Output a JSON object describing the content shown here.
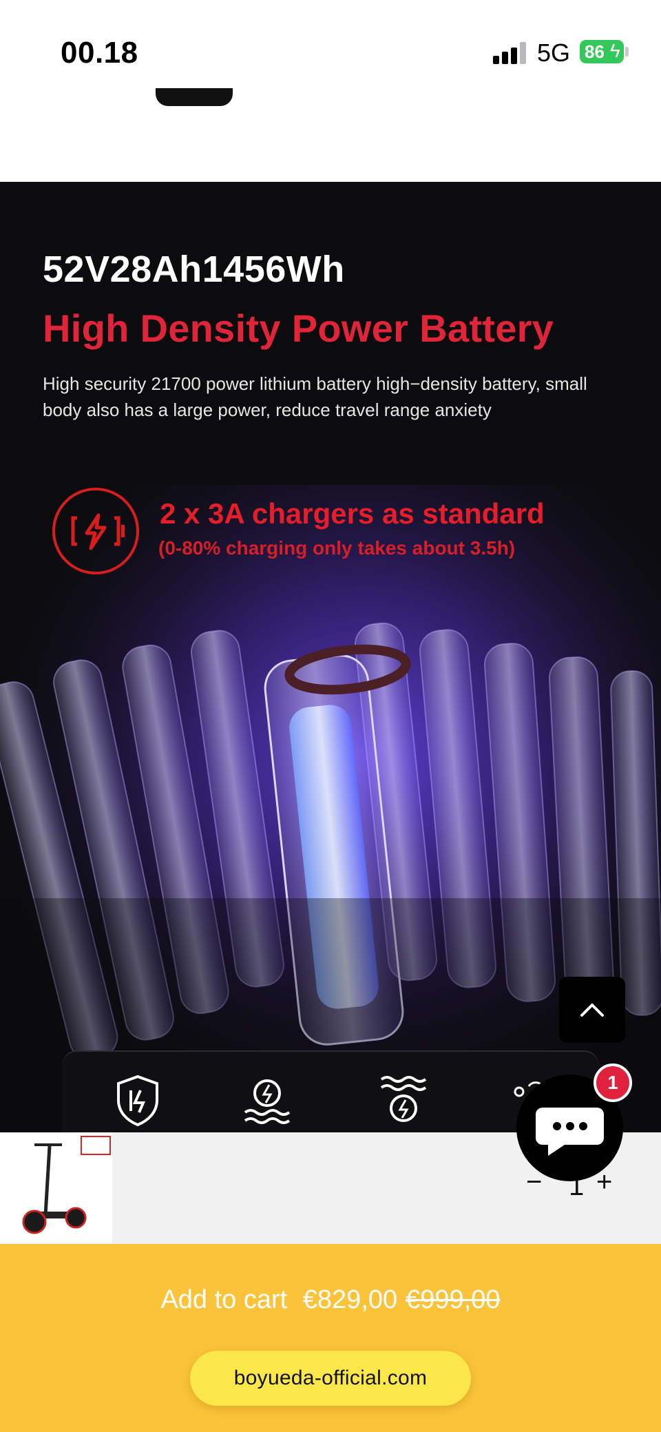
{
  "status_bar": {
    "time": "00.18",
    "network": "5G",
    "battery": "86"
  },
  "hero": {
    "capacity": "52V28Ah1456Wh",
    "title": "High Density Power Battery",
    "description": "High security 21700 power lithium battery high−density battery, small body also has a large power, reduce travel range anxiety",
    "charger_title": "2 x 3A chargers as standard",
    "charger_subtitle": "(0-80% charging only takes about 3.5h)",
    "accent_color": "#e0243a"
  },
  "features": {
    "icons": [
      "shield-bolt-icon",
      "waterproof-motor-icon",
      "water-wave-gear-icon",
      "light-sensor-icon"
    ]
  },
  "sticky_product": {
    "quantity": "1",
    "minus": "−",
    "plus": "+"
  },
  "chat": {
    "unread_count": "1"
  },
  "cart": {
    "label": "Add to cart",
    "price": "€829,00",
    "old_price": "€999,00",
    "color": "#fbc33a"
  },
  "browser": {
    "url": "boyueda-official.com"
  }
}
